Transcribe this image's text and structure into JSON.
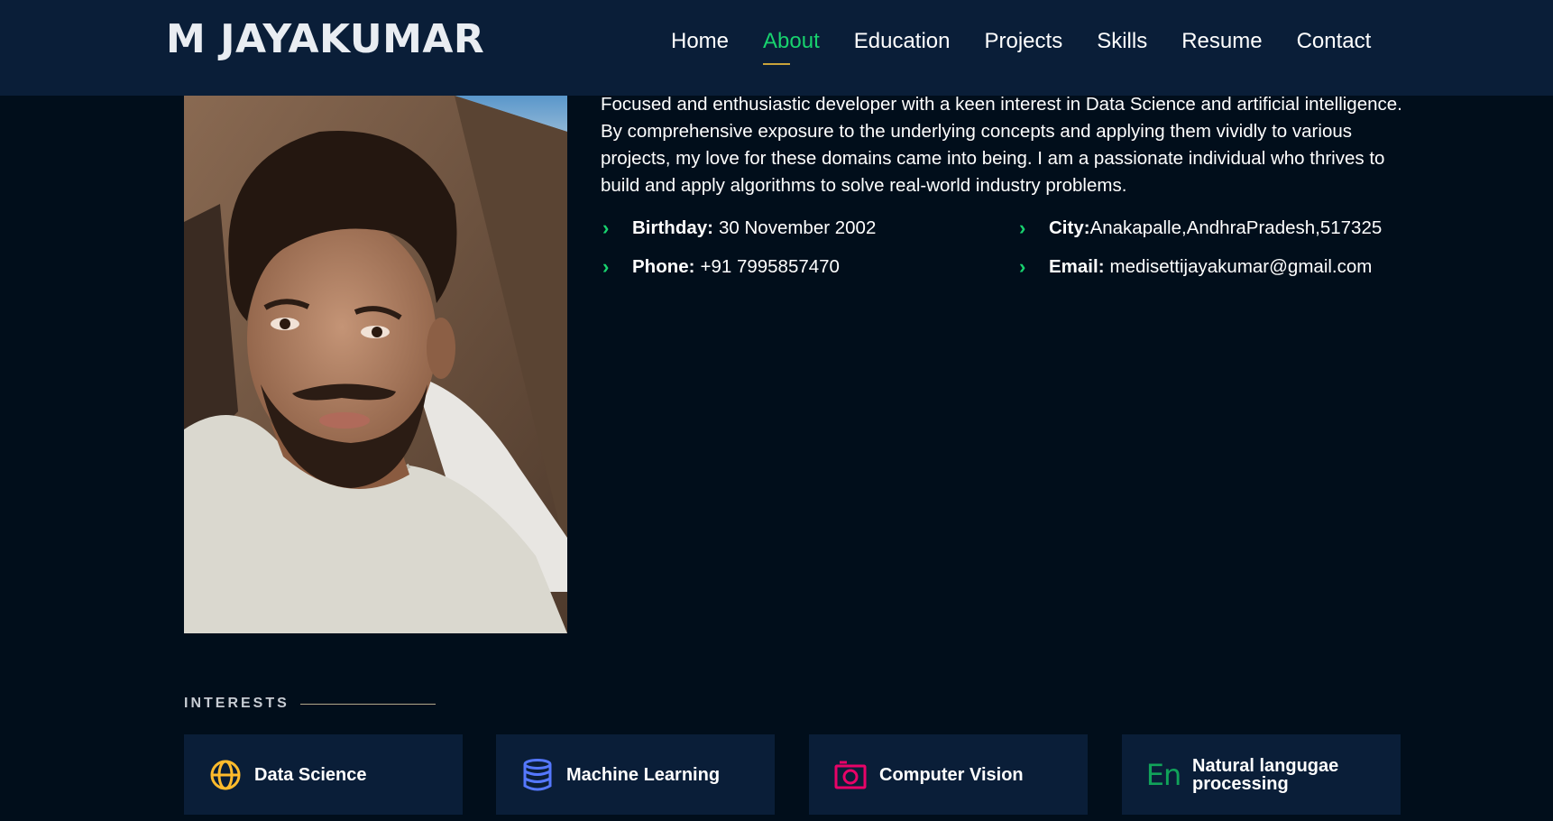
{
  "header": {
    "logo": "M JAYAKUMAR",
    "nav": [
      {
        "label": "Home"
      },
      {
        "label": "About",
        "active": true
      },
      {
        "label": "Education"
      },
      {
        "label": "Projects"
      },
      {
        "label": "Skills"
      },
      {
        "label": "Resume"
      },
      {
        "label": "Contact"
      }
    ]
  },
  "about": {
    "description": "Focused and enthusiastic developer with a keen interest in Data Science and artificial intelligence. By comprehensive exposure to the underlying concepts and applying them vividly to various projects, my love for these domains came into being. I am a passionate individual who thrives to build and apply algorithms to solve real-world industry problems.",
    "details": {
      "birthday_label": "Birthday:",
      "birthday": "30 November 2002",
      "city_label": "City:",
      "city": "Anakapalle,AndhraPradesh,517325",
      "phone_label": "Phone:",
      "phone": "+91 7995857470",
      "email_label": "Email:",
      "email": "medisettijayakumar@gmail.com"
    }
  },
  "interests": {
    "title": "INTERESTS",
    "items": [
      {
        "label": "Data Science",
        "icon": "globe-icon",
        "color": "#ffbb2c"
      },
      {
        "label": "Machine Learning",
        "icon": "database-icon",
        "color": "#5578ff"
      },
      {
        "label": "Computer Vision",
        "icon": "camera-icon",
        "color": "#e80368"
      },
      {
        "label_line1": "Natural langugae",
        "label_line2": "processing",
        "icon": "en-icon",
        "icon_text": "En",
        "color": "#11a35a"
      }
    ]
  },
  "colors": {
    "accent": "#18d26e",
    "header_bg": "#0a1e38",
    "page_bg": "#010e1b",
    "card_bg": "#0a1e38"
  }
}
